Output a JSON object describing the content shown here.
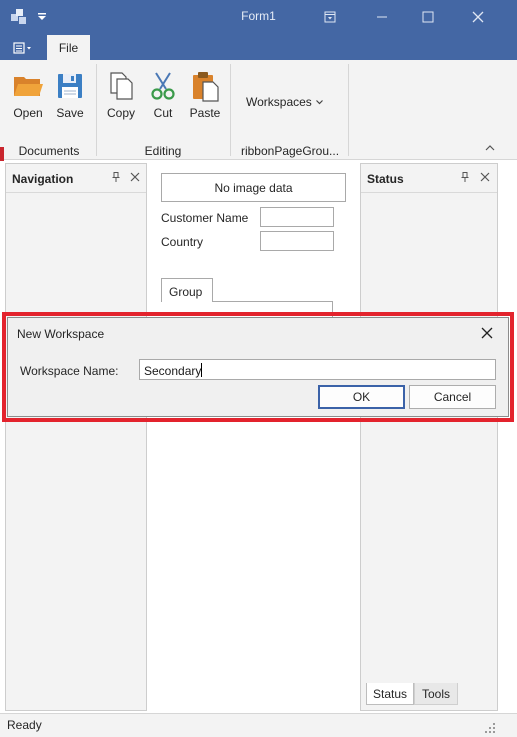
{
  "window": {
    "title": "Form1",
    "titlebar_color": "#4467a4"
  },
  "ribbon": {
    "tabs": [
      {
        "label": "File"
      }
    ],
    "groups": [
      {
        "caption": "Documents",
        "buttons": [
          {
            "label": "Open",
            "icon": "folder-open-icon"
          },
          {
            "label": "Save",
            "icon": "floppy-disk-icon"
          }
        ]
      },
      {
        "caption": "Editing",
        "buttons": [
          {
            "label": "Copy",
            "icon": "copy-icon"
          },
          {
            "label": "Cut",
            "icon": "scissors-icon"
          },
          {
            "label": "Paste",
            "icon": "clipboard-paste-icon"
          }
        ]
      },
      {
        "caption": "ribbonPageGrou...",
        "buttons": [
          {
            "label": "Workspaces",
            "icon": "chevron-down-icon"
          }
        ]
      }
    ]
  },
  "navigation_panel": {
    "title": "Navigation"
  },
  "status_panel": {
    "title": "Status",
    "tabs": [
      {
        "label": "Status",
        "active": true
      },
      {
        "label": "Tools",
        "active": false
      }
    ]
  },
  "form": {
    "image_placeholder": "No image data",
    "fields": [
      {
        "label": "Customer Name",
        "value": ""
      },
      {
        "label": "Country",
        "value": ""
      }
    ],
    "group_tab": "Group"
  },
  "dialog": {
    "title": "New Workspace",
    "field_label": "Workspace Name:",
    "field_value": "Secondary",
    "ok_label": "OK",
    "cancel_label": "Cancel",
    "highlight_color": "#e3232d"
  },
  "statusbar": {
    "text": "Ready"
  }
}
